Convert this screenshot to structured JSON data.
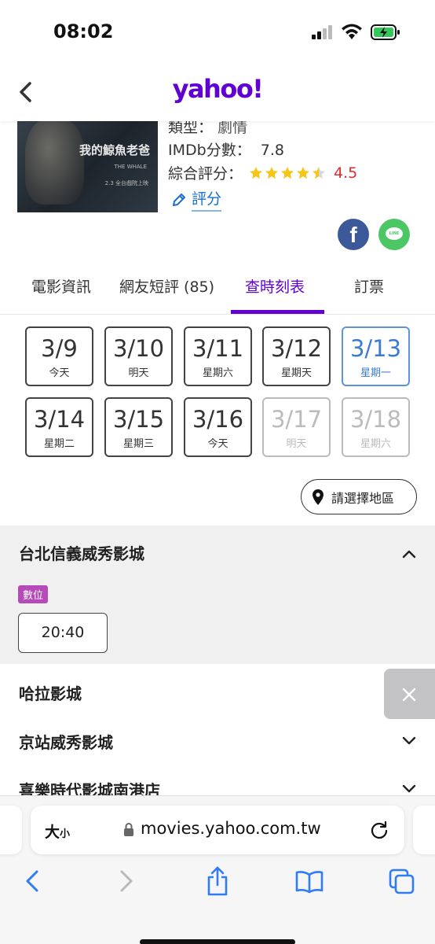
{
  "status_bar": {
    "time": "08:02"
  },
  "nav": {
    "logo": "yahoo!"
  },
  "movie": {
    "poster_title": "我的鯨魚老爸",
    "poster_sub1": "THE WHALE",
    "poster_sub2": "2.3 全台戲院上映",
    "type_label": "類型：",
    "type_value": "劇情",
    "imdb_label": "IMDb分數：",
    "imdb_value": "7.8",
    "score_label": "綜合評分：",
    "score_value": "4.5",
    "score_stars": 4.5,
    "rate_label": "評分"
  },
  "social": {
    "facebook": "f",
    "line": "LINE"
  },
  "tabs": [
    {
      "label": "電影資訊"
    },
    {
      "label": "網友短評 (85)"
    },
    {
      "label": "查時刻表"
    },
    {
      "label": "訂票"
    }
  ],
  "active_tab": "查時刻表",
  "dates": [
    {
      "date": "3/9",
      "weekday": "今天",
      "state": "normal"
    },
    {
      "date": "3/10",
      "weekday": "明天",
      "state": "normal"
    },
    {
      "date": "3/11",
      "weekday": "星期六",
      "state": "normal"
    },
    {
      "date": "3/12",
      "weekday": "星期天",
      "state": "normal"
    },
    {
      "date": "3/13",
      "weekday": "星期一",
      "state": "selected"
    },
    {
      "date": "3/14",
      "weekday": "星期二",
      "state": "normal"
    },
    {
      "date": "3/15",
      "weekday": "星期三",
      "state": "normal"
    },
    {
      "date": "3/16",
      "weekday": "今天",
      "state": "normal"
    },
    {
      "date": "3/17",
      "weekday": "明天",
      "state": "disabled"
    },
    {
      "date": "3/18",
      "weekday": "星期六",
      "state": "disabled"
    }
  ],
  "region_button": "請選擇地區",
  "theaters": [
    {
      "name": "台北信義威秀影城",
      "expanded": true,
      "format": "數位",
      "times": [
        "20:40"
      ]
    },
    {
      "name": "哈拉影城",
      "expanded": false
    },
    {
      "name": "京站威秀影城",
      "expanded": false
    },
    {
      "name": "喜樂時代影城南港店",
      "expanded": false
    }
  ],
  "safari": {
    "text_size": "大",
    "text_size_small": "小",
    "url": "movies.yahoo.com.tw"
  },
  "colors": {
    "brand_purple": "#6001d2",
    "selected_blue": "#3a7bd5",
    "score_red": "#e0292b",
    "star_yellow": "#f5c518",
    "tag_purple": "#b64ab8"
  }
}
